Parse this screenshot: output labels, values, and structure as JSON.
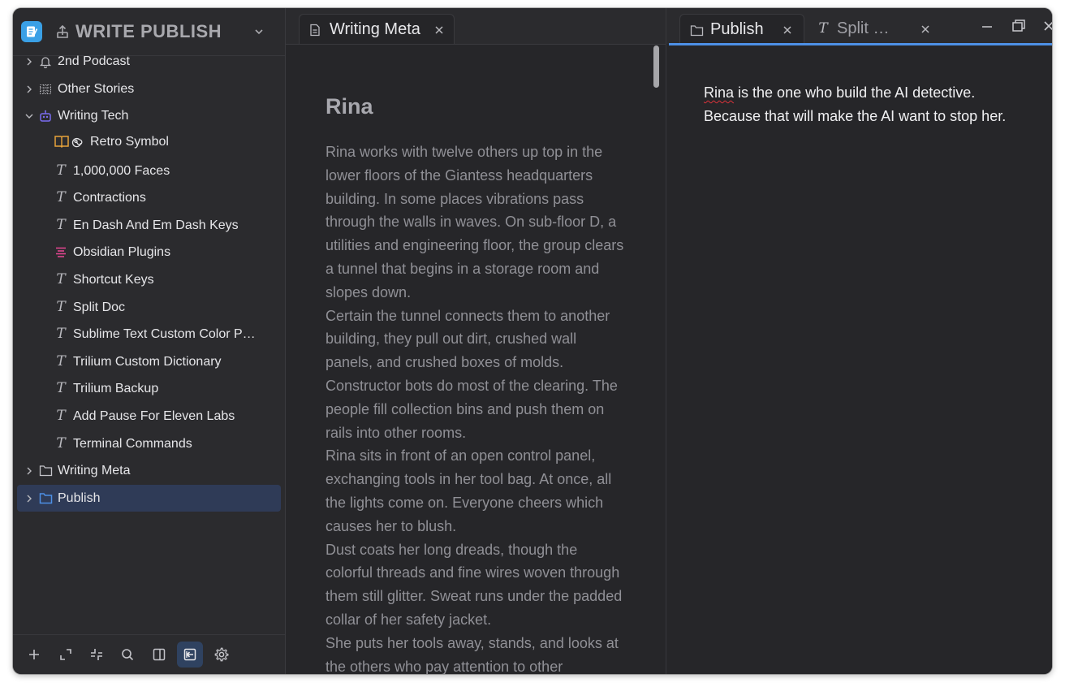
{
  "sidebar": {
    "workspace_title": "WRITE PUBLISH",
    "tree": [
      {
        "label": "2nd Podcast",
        "icon": "bell-icon",
        "level": 0,
        "expander": "collapsed"
      },
      {
        "label": "Other Stories",
        "icon": "grid-icon",
        "level": 0,
        "expander": "collapsed"
      },
      {
        "label": "Writing Tech",
        "icon": "robot-icon",
        "level": 0,
        "expander": "expanded"
      },
      {
        "label": "Retro Symbol",
        "icon": "book-spiral-icon",
        "level": 1
      },
      {
        "label": "1,000,000 Faces",
        "icon": "text-note-icon",
        "level": 1
      },
      {
        "label": "Contractions",
        "icon": "text-note-icon",
        "level": 1
      },
      {
        "label": "En Dash And Em Dash Keys",
        "icon": "text-note-icon",
        "level": 1
      },
      {
        "label": "Obsidian Plugins",
        "icon": "list-icon",
        "level": 1
      },
      {
        "label": "Shortcut Keys",
        "icon": "text-note-icon",
        "level": 1
      },
      {
        "label": "Split Doc",
        "icon": "text-note-icon",
        "level": 1
      },
      {
        "label": "Sublime Text Custom Color P…",
        "icon": "text-note-icon",
        "level": 1
      },
      {
        "label": "Trilium Custom Dictionary",
        "icon": "text-note-icon",
        "level": 1
      },
      {
        "label": "Trilium Backup",
        "icon": "text-note-icon",
        "level": 1
      },
      {
        "label": "Add Pause For Eleven Labs",
        "icon": "text-note-icon",
        "level": 1
      },
      {
        "label": "Terminal Commands",
        "icon": "text-note-icon",
        "level": 1
      },
      {
        "label": "Writing Meta",
        "icon": "folder-icon",
        "level": 0,
        "expander": "collapsed"
      },
      {
        "label": "Publish",
        "icon": "folder-icon",
        "level": 0,
        "expander": "collapsed",
        "selected": true
      }
    ],
    "footer_buttons": [
      "add-icon",
      "expand-icon",
      "collapse-icon",
      "search-icon",
      "split-panel-icon",
      "hoist-icon",
      "gear-icon"
    ]
  },
  "left_pane": {
    "tab_label": "Writing Meta",
    "doc_title": "Rina",
    "paragraphs": [
      "Rina works with twelve others up top in the lower floors of the Giantess headquarters building. In some places vibrations pass through the walls in waves. On sub-floor D, a utilities and engineering floor, the group clears a tunnel that begins in a storage room and slopes down.",
      "Certain the tunnel connects them to another building, they pull out dirt, crushed wall panels, and crushed boxes of molds. Constructor bots do most of the clearing. The people fill collection bins and push them on rails into other rooms.",
      "Rina sits in front of an open control panel, exchanging tools in her tool bag. At once, all the lights come on. Everyone cheers which causes her to blush.",
      "Dust coats her long dreads, though the colorful threads and fine wires woven through them still glitter. Sweat runs under the padded collar of her safety jacket.",
      "She puts her tools away, stands, and looks at the others who pay attention to other"
    ]
  },
  "right_pane": {
    "tabs": [
      {
        "label": "Publish",
        "icon": "folder-icon",
        "active": true
      },
      {
        "label": "Split …",
        "icon": "text-note-icon",
        "active": false
      }
    ],
    "note_spell_word": "Rina",
    "note_line1_rest": " is the one who build the AI detective.",
    "note_line2": "Because that will make the AI want to stop her."
  },
  "colors": {
    "accent": "#4d90e6",
    "selected_bg": "#2f3b57",
    "robot": "#7a6cf0",
    "book": "#e8a33a",
    "list": "#e0468f"
  }
}
